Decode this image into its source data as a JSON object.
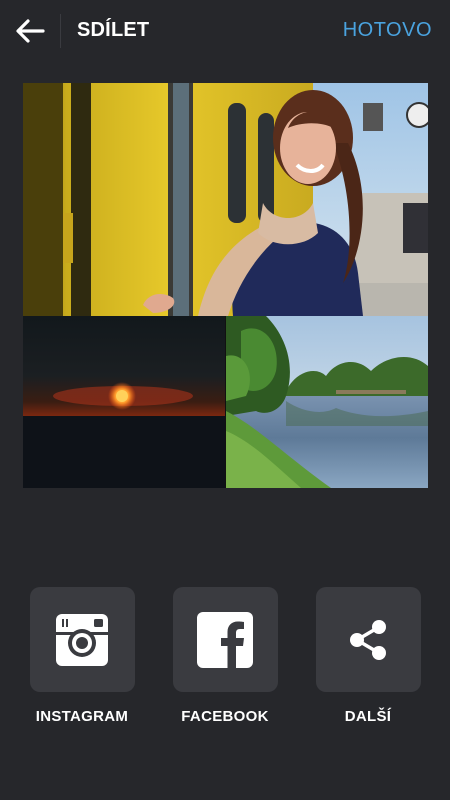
{
  "header": {
    "back_icon": "arrow-left-icon",
    "title": "SDÍLET",
    "done_label": "HOTOVO",
    "done_color": "#4aa3df"
  },
  "collage": {
    "photos": [
      {
        "name": "woman-at-yellow-train"
      },
      {
        "name": "sunset-over-horizon"
      },
      {
        "name": "lake-with-trees"
      }
    ]
  },
  "share": {
    "items": [
      {
        "label": "INSTAGRAM",
        "icon": "instagram-icon"
      },
      {
        "label": "FACEBOOK",
        "icon": "facebook-icon"
      },
      {
        "label": "DALŠÍ",
        "icon": "share-icon"
      }
    ]
  },
  "colors": {
    "background": "#26272b",
    "tile": "#3a3b40",
    "accent": "#4aa3df"
  }
}
